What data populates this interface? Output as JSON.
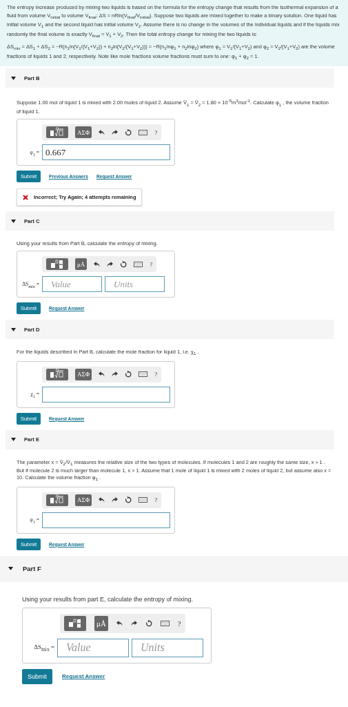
{
  "intro": {
    "paragraphs": [
      "The entropy increase produced by mixing two liquids is based on the formula for the entropy change that results from the isothermal expansion of a fluid from volume V$_{initial}$ to volume V$_{final}$: ΔS = nRln(V$_{final}$/V$_{initial}$). Suppose two liquids are mixed together to make a binary solution. One liquid has initial volume V$_{1}$ and the second liquid has initial volume V$_{2}$. Assume there is no change in the volumes of the individual liquids and if the liquids mix randomly the final volume is exactly V$_{final}$ = V$_{1}$ + V$_{2}$. Then the total entropy change for mixing the two liquids is:",
      "ΔS$_{mix}$ = ΔS$_{1}$ + ΔS$_{2}$ = −R(n$_{1}$ln(V$_{1}$/(V$_{1}$+V$_{2}$)) + n$_{2}$ln(V$_{2}$/(V$_{1}$+V$_{2}$))) = −R(n$_{1}$lnφ$_{1}$ + n$_{2}$lnφ$_{2}$) where φ$_{1}$ = V$_{1}$/(V$_{1}$+V$_{2}$) and φ$_{2}$ = V$_{2}$/(V$_{1}$+V$_{2}$) are the volume fractions of liquids 1 and 2, respectively. Note like mole fractions volume fractions must sum to one: φ$_{1}$ + φ$_{2}$ = 1."
    ]
  },
  "parts": [
    {
      "title": "Part B",
      "expanded": true,
      "prompt": "Suppose 1.00 mol of liquid 1 is mixed with 2.00 moles of liquid 2. Assume V̄$_{1}$ = V̄$_{2}$ = 1.80 × 10$^{-5}$m$^{3}$mol$^{-1}$. Calculate φ$_{1}$ , the volume fraction of liquid 1.",
      "toolbar": {
        "kind": "templates",
        "symbols": "ΑΣΦ",
        "help": "?"
      },
      "label": "φ$_{1}$ =",
      "fields": [
        {
          "kind": "answer",
          "value": "0.667"
        }
      ],
      "submit": "Submit",
      "links": [
        "Previous Answers",
        "Request Answer"
      ],
      "feedback": {
        "kind": "incorrect",
        "text": "Incorrect; Try Again; 4 attempts remaining"
      }
    },
    {
      "title": "Part C",
      "expanded": true,
      "prompt": "Using your results from Part B, calculate the entropy of mixing.",
      "toolbar": {
        "kind": "units",
        "symbols": "μÅ",
        "help": "?"
      },
      "label": "ΔS$_{mix}$ =",
      "fields": [
        {
          "kind": "value",
          "placeholder": "Value"
        },
        {
          "kind": "units",
          "placeholder": "Units"
        }
      ],
      "submit": "Submit",
      "links": [
        "Request Answer"
      ]
    },
    {
      "title": "Part D",
      "expanded": true,
      "prompt": "For the liquids described in Part B, calculate the mole fraction for liquid 1, i.e. χ$_{1}$ .",
      "toolbar": {
        "kind": "templates",
        "symbols": "ΑΣΦ",
        "help": "?"
      },
      "label": "χ$_{1}$ =",
      "fields": [
        {
          "kind": "answer"
        }
      ],
      "submit": "Submit",
      "links": [
        "Request Answer"
      ]
    },
    {
      "title": "Part E",
      "expanded": true,
      "prompt": "The parameter x = V̄$_{2}$/V̄$_{1}$ measures the relative size of the two types of molecules. If molecules 1 and 2 are roughly the same size, x ≈ 1 . But if molecule 2 is much larger than molecule 1, x > 1. Assume that 1 mole of liquid 1 is mixed with 2 moles of liquid 2, but assume also x = 10. Calculate the volume fraction φ$_{1}$ .",
      "toolbar": {
        "kind": "templates",
        "symbols": "ΑΣΦ",
        "help": "?"
      },
      "label": "φ$_{1}$ =",
      "fields": [
        {
          "kind": "answer"
        }
      ],
      "submit": "Submit",
      "links": [
        "Request Answer"
      ]
    },
    {
      "title": "Part F",
      "expanded": true,
      "prompt": "Using your results from part E, calculate the entropy of mixing.",
      "toolbar": {
        "kind": "units",
        "symbols": "μÅ",
        "help": "?"
      },
      "label": "ΔS$_{mix}$ =",
      "fields": [
        {
          "kind": "value",
          "placeholder": "Value"
        },
        {
          "kind": "units",
          "placeholder": "Units"
        }
      ],
      "submit": "Submit",
      "links": [
        "Request Answer"
      ]
    }
  ]
}
